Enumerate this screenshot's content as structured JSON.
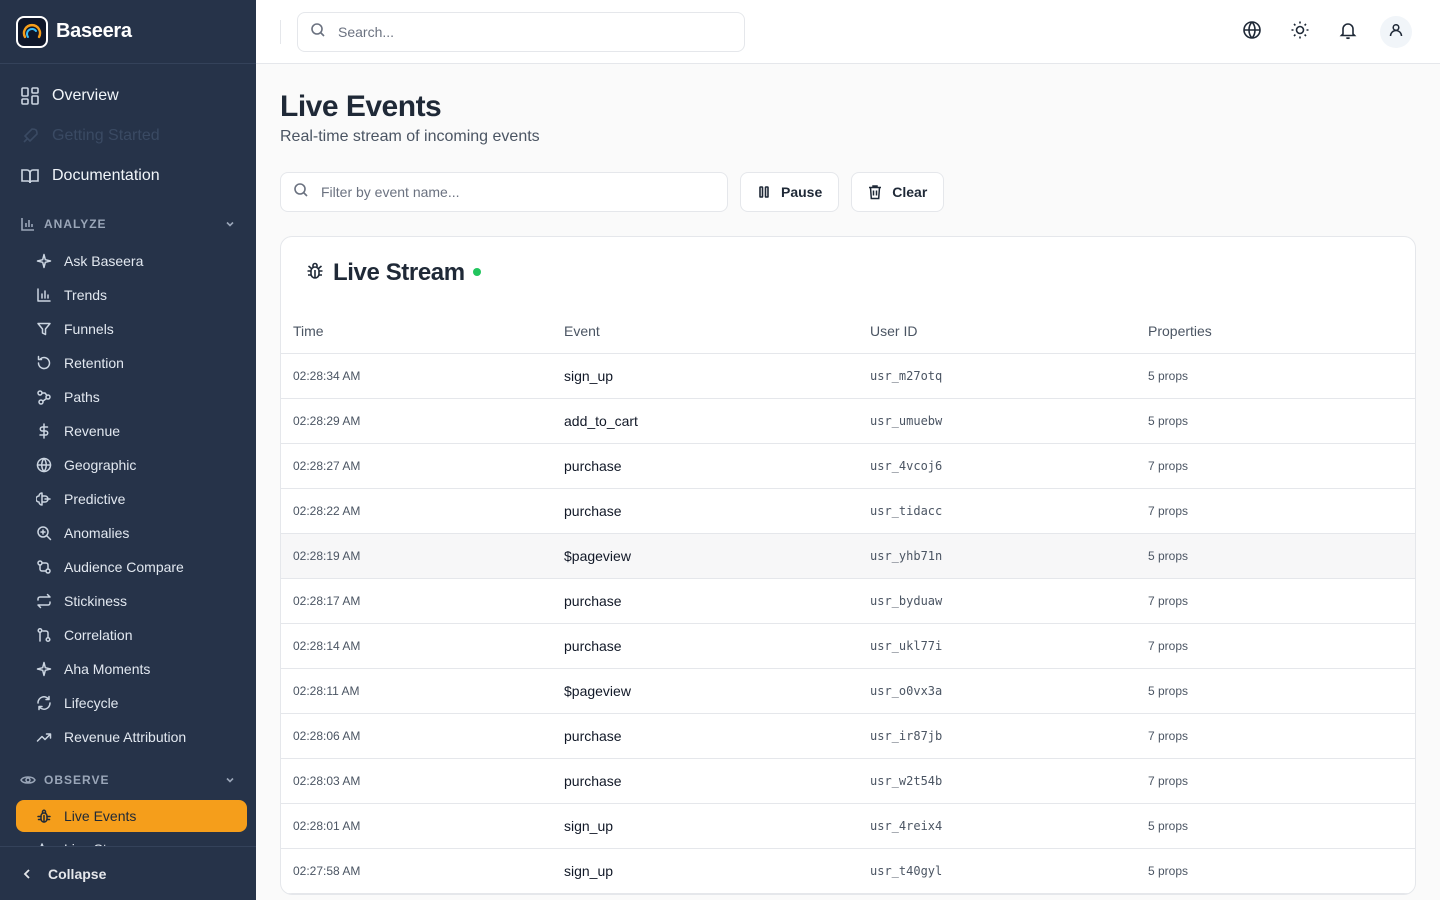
{
  "brand": {
    "name": "Baseera"
  },
  "nav": {
    "top": [
      {
        "label": "Overview",
        "icon": "grid-icon"
      },
      {
        "label": "Getting Started",
        "icon": "rocket-icon",
        "disabled": true
      },
      {
        "label": "Documentation",
        "icon": "book-icon"
      }
    ],
    "analyze": {
      "title": "ANALYZE",
      "items": [
        {
          "label": "Ask Baseera",
          "icon": "sparkles-icon"
        },
        {
          "label": "Trends",
          "icon": "bar-chart-icon"
        },
        {
          "label": "Funnels",
          "icon": "funnel-icon"
        },
        {
          "label": "Retention",
          "icon": "rotate-ccw-icon"
        },
        {
          "label": "Paths",
          "icon": "workflow-icon"
        },
        {
          "label": "Revenue",
          "icon": "dollar-icon"
        },
        {
          "label": "Geographic",
          "icon": "globe-icon"
        },
        {
          "label": "Predictive",
          "icon": "brain-icon"
        },
        {
          "label": "Anomalies",
          "icon": "zoom-icon"
        },
        {
          "label": "Audience Compare",
          "icon": "compare-icon"
        },
        {
          "label": "Stickiness",
          "icon": "repeat-icon"
        },
        {
          "label": "Correlation",
          "icon": "git-compare-icon"
        },
        {
          "label": "Aha Moments",
          "icon": "sparkles-icon"
        },
        {
          "label": "Lifecycle",
          "icon": "refresh-icon"
        },
        {
          "label": "Revenue Attribution",
          "icon": "trending-up-icon"
        }
      ]
    },
    "observe": {
      "title": "OBSERVE",
      "items": [
        {
          "label": "Live Events",
          "icon": "bug-icon",
          "active": true
        },
        {
          "label": "Live Stream",
          "icon": "activity-icon"
        }
      ]
    },
    "collapse_label": "Collapse"
  },
  "topbar": {
    "search_placeholder": "Search..."
  },
  "page": {
    "title": "Live Events",
    "subtitle": "Real-time stream of incoming events",
    "filter_placeholder": "Filter by event name...",
    "pause_label": "Pause",
    "clear_label": "Clear"
  },
  "stream": {
    "title": "Live Stream",
    "status_color": "#22c55e",
    "columns": [
      "Time",
      "Event",
      "User ID",
      "Properties"
    ],
    "rows": [
      {
        "time": "02:28:34 AM",
        "event": "sign_up",
        "user": "usr_m27otq",
        "props": "5 props"
      },
      {
        "time": "02:28:29 AM",
        "event": "add_to_cart",
        "user": "usr_umuebw",
        "props": "5 props"
      },
      {
        "time": "02:28:27 AM",
        "event": "purchase",
        "user": "usr_4vcoj6",
        "props": "7 props"
      },
      {
        "time": "02:28:22 AM",
        "event": "purchase",
        "user": "usr_tidacc",
        "props": "7 props"
      },
      {
        "time": "02:28:19 AM",
        "event": "$pageview",
        "user": "usr_yhb71n",
        "props": "5 props"
      },
      {
        "time": "02:28:17 AM",
        "event": "purchase",
        "user": "usr_byduaw",
        "props": "7 props"
      },
      {
        "time": "02:28:14 AM",
        "event": "purchase",
        "user": "usr_ukl77i",
        "props": "7 props"
      },
      {
        "time": "02:28:11 AM",
        "event": "$pageview",
        "user": "usr_o0vx3a",
        "props": "5 props"
      },
      {
        "time": "02:28:06 AM",
        "event": "purchase",
        "user": "usr_ir87jb",
        "props": "7 props"
      },
      {
        "time": "02:28:03 AM",
        "event": "purchase",
        "user": "usr_w2t54b",
        "props": "7 props"
      },
      {
        "time": "02:28:01 AM",
        "event": "sign_up",
        "user": "usr_4reix4",
        "props": "5 props"
      },
      {
        "time": "02:27:58 AM",
        "event": "sign_up",
        "user": "usr_t40gyl",
        "props": "5 props"
      }
    ]
  },
  "colors": {
    "sidebar_bg": "#263349",
    "accent": "#f59e1b"
  }
}
